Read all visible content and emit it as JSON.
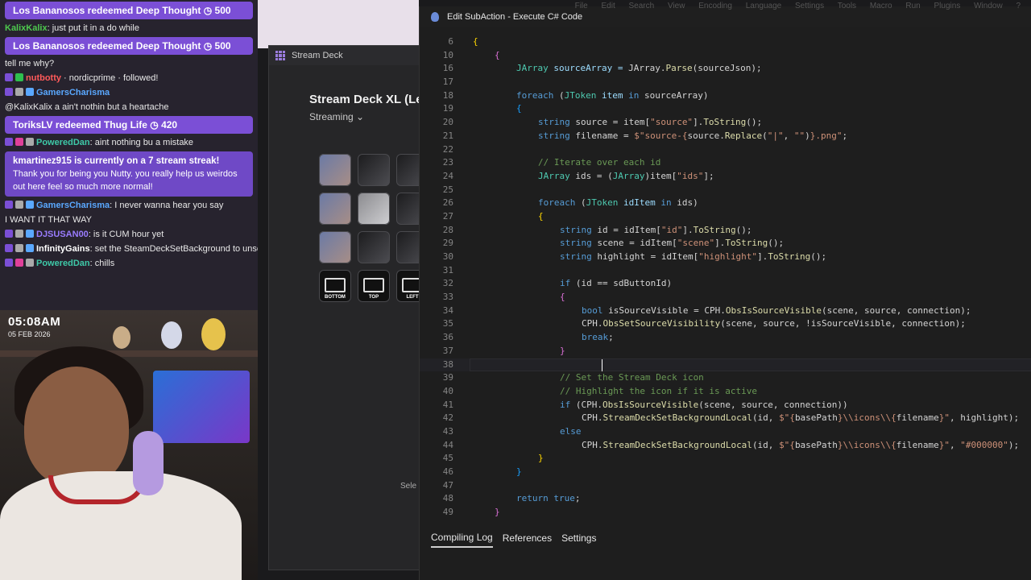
{
  "chat": {
    "lines": [
      {
        "kind": "redeem",
        "text": "Los Bananosos redeemed Deep Thought",
        "cost": "500"
      },
      {
        "kind": "msg",
        "user": "KalixKalix",
        "user_color": "#4ec94e",
        "text": ": just put it in a do while",
        "badges": []
      },
      {
        "kind": "redeem",
        "text": "Los Bananosos redeemed Deep Thought",
        "cost": "500"
      },
      {
        "kind": "plain",
        "text": "tell me why?"
      },
      {
        "kind": "msg",
        "user": "nutbotty",
        "user_color": "#ff5a5a",
        "text": " · nordicprime · followed!",
        "badges": [
          "#7b4fd6",
          "#2fbf4f"
        ]
      },
      {
        "kind": "msg",
        "user": "GamersCharisma",
        "user_color": "#5aa8ff",
        "text": "",
        "badges": [
          "#7b4fd6",
          "#aaaaaa",
          "#5aa8ff"
        ]
      },
      {
        "kind": "plain",
        "text": "@KalixKalix a ain't nothin but a heartache"
      },
      {
        "kind": "redeem",
        "text": "ToriksLV redeemed Thug Life",
        "cost": "420"
      },
      {
        "kind": "msg",
        "user": "PoweredDan",
        "user_color": "#3ec9a8",
        "text": ": aint nothing bu a mistake",
        "badges": [
          "#7b4fd6",
          "#e0409a",
          "#aaaaaa"
        ]
      },
      {
        "kind": "streak",
        "head": "kmartinez915 is currently on a 7 stream streak!",
        "text": "Thank you for being you Nutty. you really help us weirdos out here feel so much more normal!"
      },
      {
        "kind": "msg",
        "user": "GamersCharisma",
        "user_color": "#5aa8ff",
        "text": ": I never wanna hear you say",
        "badges": [
          "#7b4fd6",
          "#aaaaaa",
          "#5aa8ff"
        ]
      },
      {
        "kind": "plain",
        "text": "I WANT IT THAT WAY"
      },
      {
        "kind": "msg",
        "user": "DJSUSAN00",
        "user_color": "#9a7cff",
        "text": ": is it CUM hour yet",
        "badges": [
          "#7b4fd6",
          "#aaaaaa",
          "#5aa8ff"
        ]
      },
      {
        "kind": "msg",
        "user": "InfinityGains",
        "user_color": "#ffffff",
        "text": ": set the SteamDeckSetBackground to unselected before the other code",
        "badges": [
          "#7b4fd6",
          "#aaaaaa",
          "#5aa8ff"
        ]
      },
      {
        "kind": "msg",
        "user": "PoweredDan",
        "user_color": "#3ec9a8",
        "text": ": chills",
        "badges": [
          "#7b4fd6",
          "#e0409a",
          "#aaaaaa"
        ]
      }
    ]
  },
  "webcam": {
    "time": "05:08AM",
    "date": "05 FEB 2026"
  },
  "streamdeck": {
    "window_title": "Stream Deck",
    "device": "Stream Deck XL (Le",
    "profile": "Streaming",
    "keys": [
      {
        "style": "img"
      },
      {
        "style": "dark"
      },
      {
        "style": "dark"
      },
      {
        "style": "img"
      },
      {
        "style": "grey"
      },
      {
        "style": "dark"
      },
      {
        "style": "img"
      },
      {
        "style": "dark"
      },
      {
        "style": "dark"
      },
      {
        "style": "labeled",
        "label": "BOTTOM"
      },
      {
        "style": "labeled",
        "label": "TOP"
      },
      {
        "style": "labeled",
        "label": "LEFT"
      }
    ],
    "select_text": "Sele"
  },
  "editor": {
    "title": "Edit SubAction - Execute C# Code",
    "menu": "File Edit Search View Encoding Language Settings Tools Macro Run Plugins Window ?",
    "current_line": "38",
    "lines": [
      {
        "n": "6",
        "i": 0,
        "t": [
          [
            "{",
            "br1"
          ]
        ]
      },
      {
        "n": "10",
        "i": 1,
        "t": [
          [
            "{",
            "br2"
          ]
        ]
      },
      {
        "n": "16",
        "i": 2,
        "t": [
          [
            "JArray ",
            "ty"
          ],
          [
            "sourceArray = ",
            "vr"
          ],
          [
            "JArray",
            ""
          ],
          [
            ".",
            ""
          ],
          [
            "Parse",
            "fn"
          ],
          [
            "(sourceJson);",
            ""
          ]
        ]
      },
      {
        "n": "17",
        "i": 0,
        "t": []
      },
      {
        "n": "18",
        "i": 2,
        "t": [
          [
            "foreach ",
            "kw"
          ],
          [
            "(",
            ""
          ],
          [
            "JToken ",
            "ty"
          ],
          [
            "item ",
            "vr"
          ],
          [
            "in ",
            "kw"
          ],
          [
            "sourceArray)",
            ""
          ]
        ]
      },
      {
        "n": "19",
        "i": 2,
        "t": [
          [
            "{",
            "br3"
          ]
        ]
      },
      {
        "n": "20",
        "i": 3,
        "t": [
          [
            "string ",
            "kw"
          ],
          [
            "source = item[",
            ""
          ],
          [
            "\"source\"",
            "st"
          ],
          [
            "].",
            ""
          ],
          [
            "ToString",
            "fn"
          ],
          [
            "();",
            ""
          ]
        ]
      },
      {
        "n": "21",
        "i": 3,
        "t": [
          [
            "string ",
            "kw"
          ],
          [
            "filename = ",
            ""
          ],
          [
            "$\"source-{",
            "st"
          ],
          [
            "source.",
            ""
          ],
          [
            "Replace",
            "fn"
          ],
          [
            "(",
            ""
          ],
          [
            "\"|\"",
            "st"
          ],
          [
            ", ",
            ""
          ],
          [
            "\"\"",
            "st"
          ],
          [
            ")",
            ""
          ],
          [
            "}.png\"",
            "st"
          ],
          [
            ";",
            ""
          ]
        ]
      },
      {
        "n": "22",
        "i": 0,
        "t": []
      },
      {
        "n": "23",
        "i": 3,
        "t": [
          [
            "// Iterate over each id",
            "cm"
          ]
        ]
      },
      {
        "n": "24",
        "i": 3,
        "t": [
          [
            "JArray ",
            "ty"
          ],
          [
            "ids = (",
            ""
          ],
          [
            "JArray",
            "ty"
          ],
          [
            ")item[",
            ""
          ],
          [
            "\"ids\"",
            "st"
          ],
          [
            "];",
            ""
          ]
        ]
      },
      {
        "n": "25",
        "i": 0,
        "t": []
      },
      {
        "n": "26",
        "i": 3,
        "t": [
          [
            "foreach ",
            "kw"
          ],
          [
            "(",
            ""
          ],
          [
            "JToken ",
            "ty"
          ],
          [
            "idItem ",
            "vr"
          ],
          [
            "in ",
            "kw"
          ],
          [
            "ids)",
            ""
          ]
        ]
      },
      {
        "n": "27",
        "i": 3,
        "t": [
          [
            "{",
            "br1"
          ]
        ]
      },
      {
        "n": "28",
        "i": 4,
        "t": [
          [
            "string ",
            "kw"
          ],
          [
            "id = idItem[",
            ""
          ],
          [
            "\"id\"",
            "st"
          ],
          [
            "].",
            ""
          ],
          [
            "ToString",
            "fn"
          ],
          [
            "();",
            ""
          ]
        ]
      },
      {
        "n": "29",
        "i": 4,
        "t": [
          [
            "string ",
            "kw"
          ],
          [
            "scene = idItem[",
            ""
          ],
          [
            "\"scene\"",
            "st"
          ],
          [
            "].",
            ""
          ],
          [
            "ToString",
            "fn"
          ],
          [
            "();",
            ""
          ]
        ]
      },
      {
        "n": "30",
        "i": 4,
        "t": [
          [
            "string ",
            "kw"
          ],
          [
            "highlight = idItem[",
            ""
          ],
          [
            "\"highlight\"",
            "st"
          ],
          [
            "].",
            ""
          ],
          [
            "ToString",
            "fn"
          ],
          [
            "();",
            ""
          ]
        ]
      },
      {
        "n": "31",
        "i": 0,
        "t": []
      },
      {
        "n": "32",
        "i": 4,
        "t": [
          [
            "if ",
            "kw"
          ],
          [
            "(id == sdButtonId)",
            ""
          ]
        ]
      },
      {
        "n": "33",
        "i": 4,
        "t": [
          [
            "{",
            "br2"
          ]
        ]
      },
      {
        "n": "34",
        "i": 5,
        "t": [
          [
            "bool ",
            "kw"
          ],
          [
            "isSourceVisible = CPH.",
            ""
          ],
          [
            "ObsIsSourceVisible",
            "fn"
          ],
          [
            "(scene, source, connection);",
            ""
          ]
        ]
      },
      {
        "n": "35",
        "i": 5,
        "t": [
          [
            "CPH.",
            ""
          ],
          [
            "ObsSetSourceVisibility",
            "fn"
          ],
          [
            "(scene, source, !isSourceVisible, connection);",
            ""
          ]
        ]
      },
      {
        "n": "36",
        "i": 5,
        "t": [
          [
            "break",
            "kw"
          ],
          [
            ";",
            ""
          ]
        ]
      },
      {
        "n": "37",
        "i": 4,
        "t": [
          [
            "}",
            "br2"
          ]
        ]
      },
      {
        "n": "38",
        "i": 0,
        "t": []
      },
      {
        "n": "39",
        "i": 4,
        "t": [
          [
            "// Set the Stream Deck icon",
            "cm"
          ]
        ]
      },
      {
        "n": "40",
        "i": 4,
        "t": [
          [
            "// Highlight the icon if it is active",
            "cm"
          ]
        ]
      },
      {
        "n": "41",
        "i": 4,
        "t": [
          [
            "if ",
            "kw"
          ],
          [
            "(CPH.",
            ""
          ],
          [
            "ObsIsSourceVisible",
            "fn"
          ],
          [
            "(scene, source, connection))",
            ""
          ]
        ]
      },
      {
        "n": "42",
        "i": 5,
        "t": [
          [
            "CPH.",
            ""
          ],
          [
            "StreamDeckSetBackgroundLocal",
            "fn"
          ],
          [
            "(id, ",
            ""
          ],
          [
            "$\"{",
            "st"
          ],
          [
            "basePath",
            ""
          ],
          [
            "}\\\\icons\\\\{",
            "st"
          ],
          [
            "filename",
            ""
          ],
          [
            "}\"",
            "st"
          ],
          [
            ", highlight);",
            ""
          ]
        ]
      },
      {
        "n": "43",
        "i": 4,
        "t": [
          [
            "else",
            "kw"
          ]
        ]
      },
      {
        "n": "44",
        "i": 5,
        "t": [
          [
            "CPH.",
            ""
          ],
          [
            "StreamDeckSetBackgroundLocal",
            "fn"
          ],
          [
            "(id, ",
            ""
          ],
          [
            "$\"{",
            "st"
          ],
          [
            "basePath",
            ""
          ],
          [
            "}\\\\icons\\\\{",
            "st"
          ],
          [
            "filename",
            ""
          ],
          [
            "}\"",
            "st"
          ],
          [
            ", ",
            ""
          ],
          [
            "\"#000000\"",
            "st"
          ],
          [
            ");",
            ""
          ]
        ]
      },
      {
        "n": "45",
        "i": 3,
        "t": [
          [
            "}",
            "br1"
          ]
        ]
      },
      {
        "n": "46",
        "i": 2,
        "t": [
          [
            "}",
            "br3"
          ]
        ]
      },
      {
        "n": "47",
        "i": 0,
        "t": []
      },
      {
        "n": "48",
        "i": 2,
        "t": [
          [
            "return ",
            "kw"
          ],
          [
            "true",
            "kw"
          ],
          [
            ";",
            ""
          ]
        ]
      },
      {
        "n": "49",
        "i": 1,
        "t": [
          [
            "}",
            "br2"
          ]
        ]
      }
    ],
    "tabs": [
      "Compiling Log",
      "References",
      "Settings"
    ]
  },
  "colors": {
    "accent": "#7b4fd6",
    "editor_bg": "#1e1e1e"
  }
}
